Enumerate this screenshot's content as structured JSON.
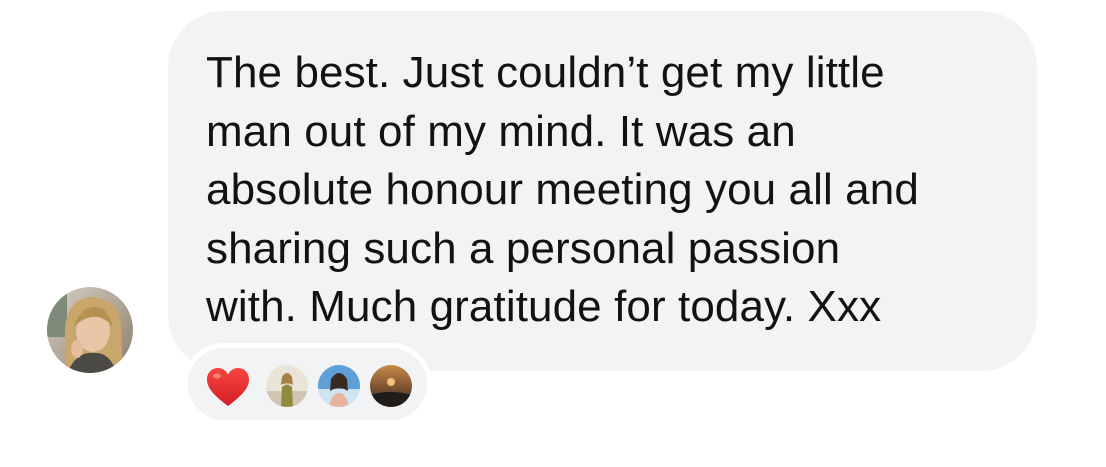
{
  "message": {
    "text": "The best. Just couldn’t get my little\nman out of my mind. It was an\nabsolute honour meeting you all and\nsharing such a personal passion\nwith. Much gratitude for today. Xxx",
    "bubble_color": "#f2f3f5",
    "text_color": "#121212"
  },
  "reactions": [
    {
      "type": "heart-emoji",
      "color": "#e8262a"
    },
    {
      "type": "reactor-avatar"
    },
    {
      "type": "reactor-avatar"
    },
    {
      "type": "reactor-avatar"
    }
  ]
}
